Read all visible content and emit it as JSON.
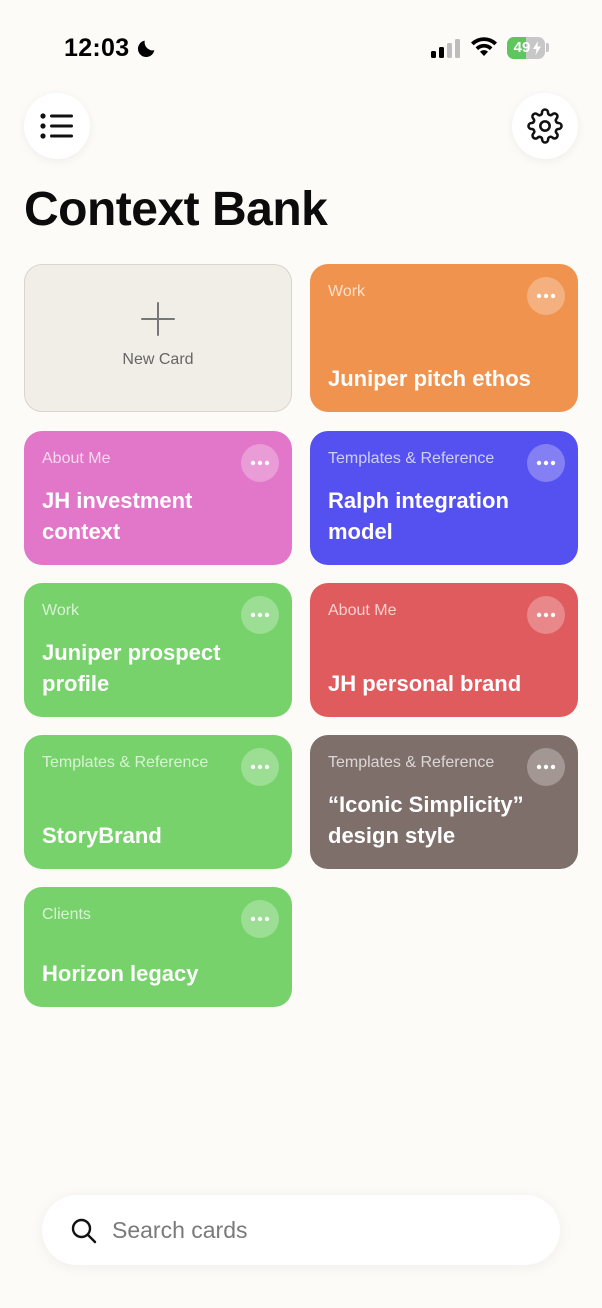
{
  "status_bar": {
    "time": "12:03",
    "battery_percent": "49",
    "battery_level": 0.49
  },
  "header": {
    "title": "Context Bank",
    "menu_icon": "list-icon",
    "settings_icon": "gear-icon"
  },
  "new_card": {
    "label": "New Card",
    "icon": "plus-icon"
  },
  "cards": [
    {
      "category": "Work",
      "title": "Juniper pitch ethos",
      "color": "#f0934e"
    },
    {
      "category": "About Me",
      "title": "JH investment context",
      "color": "#e276c8"
    },
    {
      "category": "Templates & Reference",
      "title": "Ralph integration model",
      "color": "#5550f0"
    },
    {
      "category": "Work",
      "title": "Juniper prospect profile",
      "color": "#77d26b"
    },
    {
      "category": "About Me",
      "title": "JH personal brand",
      "color": "#e05b5d"
    },
    {
      "category": "Templates & Reference",
      "title": "StoryBrand",
      "color": "#77d26b"
    },
    {
      "category": "Templates & Reference",
      "title": "“Iconic Simplicity” design style",
      "color": "#7e6f6a"
    },
    {
      "category": "Clients",
      "title": "Horizon legacy",
      "color": "#77d26b"
    }
  ],
  "search": {
    "placeholder": "Search cards",
    "value": ""
  }
}
